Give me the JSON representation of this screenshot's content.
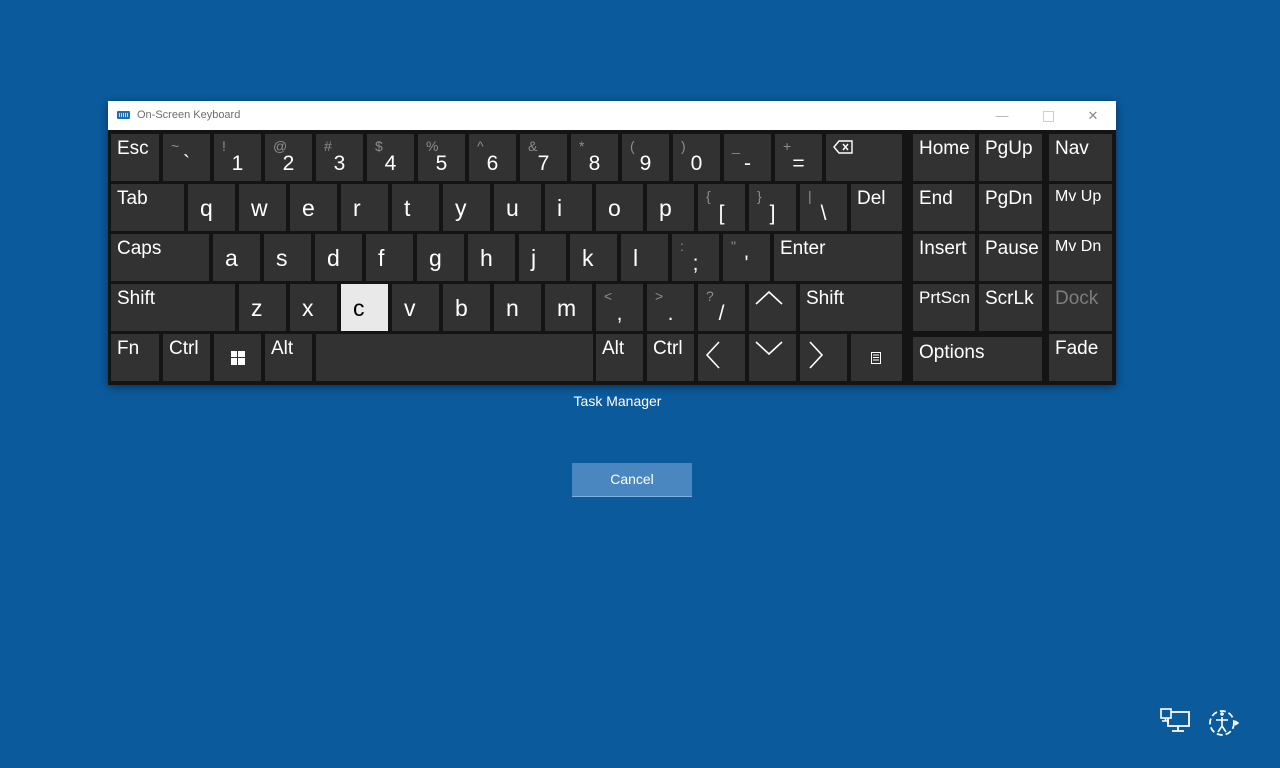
{
  "window": {
    "title": "On-Screen Keyboard",
    "minimize": "—",
    "close": "✕"
  },
  "keys": {
    "row1": [
      "Esc",
      "`",
      "1",
      "2",
      "3",
      "4",
      "5",
      "6",
      "7",
      "8",
      "9",
      "0",
      "-",
      "=",
      "backspace"
    ],
    "row1_shift": [
      "",
      "~",
      "!",
      "@",
      "#",
      "$",
      "%",
      "^",
      "&",
      "*",
      "(",
      ")",
      "_",
      "+",
      ""
    ],
    "row2": [
      "Tab",
      "q",
      "w",
      "e",
      "r",
      "t",
      "y",
      "u",
      "i",
      "o",
      "p",
      "[",
      "]",
      "\\",
      "Del"
    ],
    "row2_shift": [
      "",
      "",
      "",
      "",
      "",
      "",
      "",
      "",
      "",
      "",
      "",
      "{",
      "}",
      "|",
      ""
    ],
    "row3": [
      "Caps",
      "a",
      "s",
      "d",
      "f",
      "g",
      "h",
      "j",
      "k",
      "l",
      ";",
      "'",
      "Enter"
    ],
    "row3_shift": [
      "",
      "",
      "",
      "",
      "",
      "",
      "",
      "",
      "",
      "",
      ":",
      "\"",
      ""
    ],
    "row4": [
      "Shift",
      "z",
      "x",
      "c",
      "v",
      "b",
      "n",
      "m",
      ",",
      ".",
      "/",
      "up",
      "Shift"
    ],
    "row4_shift": [
      "",
      "",
      "",
      "",
      "",
      "",
      "",
      "",
      "<",
      ">",
      "?",
      "",
      ""
    ],
    "row5": [
      "Fn",
      "Ctrl",
      "win",
      "Alt",
      "space",
      "Alt",
      "Ctrl",
      "left",
      "down",
      "right",
      "menu"
    ],
    "nav": [
      "Home",
      "PgUp",
      "End",
      "PgDn",
      "Insert",
      "Pause",
      "PrtScn",
      "ScrLk",
      "Options"
    ],
    "side": [
      "Nav",
      "Mv Up",
      "Mv Dn",
      "Dock",
      "Fade"
    ],
    "active_key": "c",
    "disabled_key": "Dock"
  },
  "task_manager": "Task Manager",
  "cancel": "Cancel",
  "colors": {
    "desktop": "#0b5a9c",
    "key": "#323232",
    "active_key": "#e9e9e9",
    "cancel_button": "#4a86bf"
  },
  "icons": [
    "keyboard-icon",
    "backspace-icon",
    "windows-icon",
    "arrow-up-icon",
    "arrow-left-icon",
    "arrow-down-icon",
    "arrow-right-icon",
    "menu-icon",
    "network-icon",
    "ease-of-access-icon"
  ]
}
